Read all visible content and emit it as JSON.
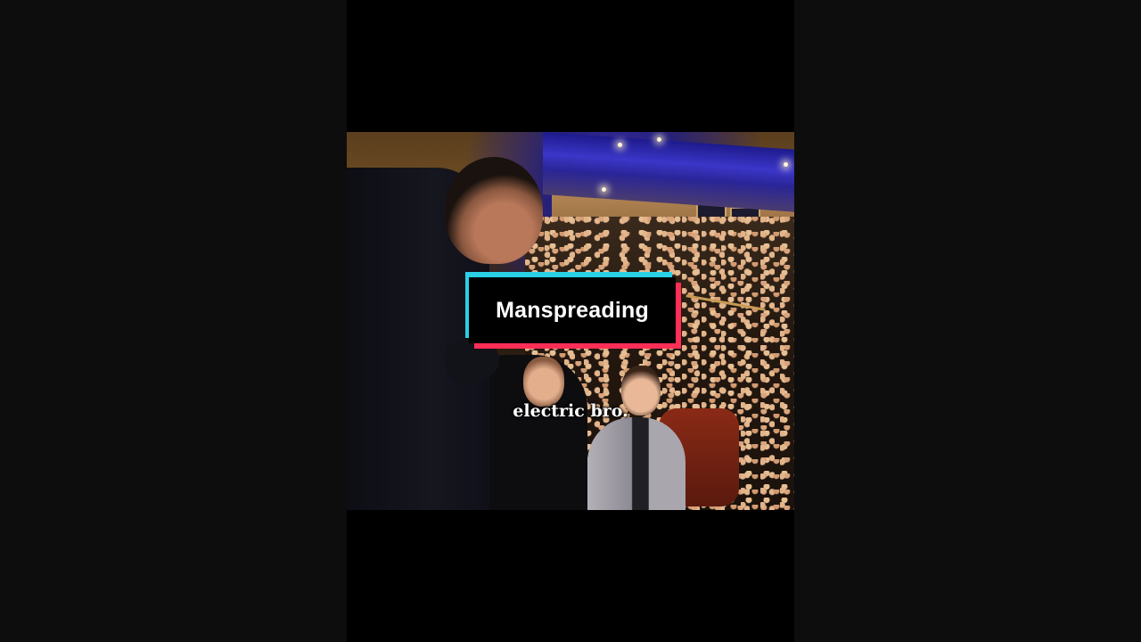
{
  "overlay": {
    "title": "Manspreading",
    "subtitle": "electric bro."
  },
  "colors": {
    "page_background": "#0d0d0d",
    "player_background": "#000000",
    "title_box": "#000000",
    "title_accent_cyan": "#2ad0e6",
    "title_accent_pink": "#ff2e57",
    "text": "#ffffff"
  }
}
